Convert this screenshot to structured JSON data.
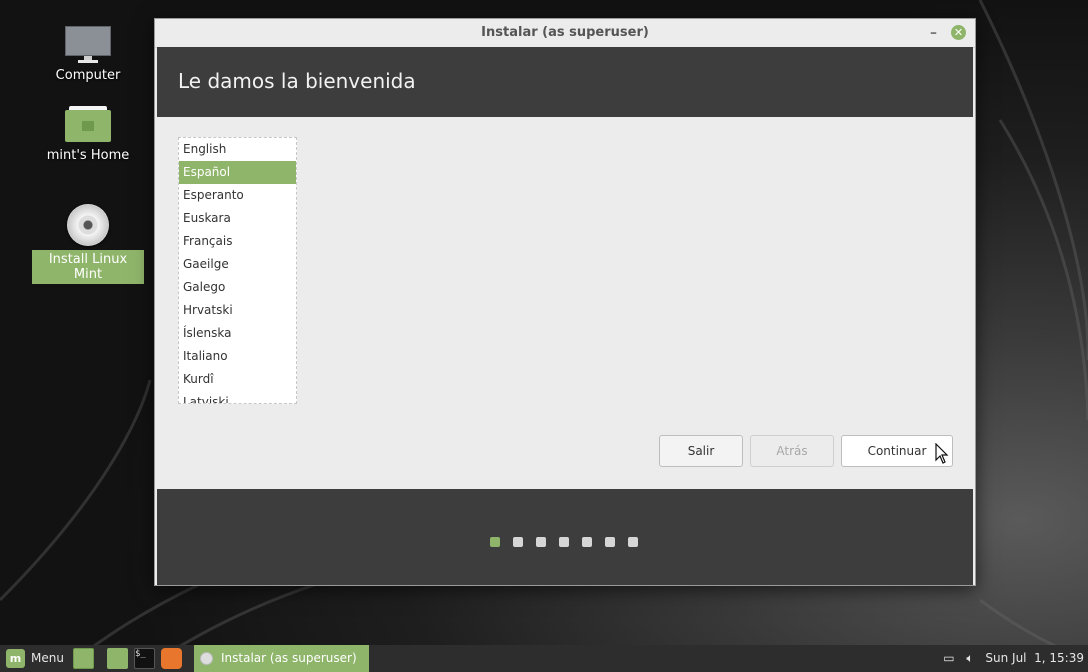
{
  "desktop": {
    "icons": [
      {
        "label": "Computer"
      },
      {
        "label": "mint's Home"
      },
      {
        "label": "Install Linux Mint"
      }
    ]
  },
  "window": {
    "title": "Instalar (as superuser)",
    "minimize_glyph": "–",
    "close_glyph": "✕",
    "heading": "Le damos la bienvenida",
    "languages": [
      "English",
      "Español",
      "Esperanto",
      "Euskara",
      "Français",
      "Gaeilge",
      "Galego",
      "Hrvatski",
      "Íslenska",
      "Italiano",
      "Kurdî",
      "Latviski"
    ],
    "selected_language": "Español",
    "buttons": {
      "quit": "Salir",
      "back": "Atrás",
      "continue": "Continuar"
    },
    "progress": {
      "steps": 7,
      "current": 1
    }
  },
  "taskbar": {
    "menu_label": "Menu",
    "task_label": "Instalar (as superuser)",
    "clock": "Sun Jul  1, 15:39"
  },
  "colors": {
    "accent": "#8fb56a",
    "panel_dark": "#3d3d3d",
    "window_bg": "#ececec"
  }
}
